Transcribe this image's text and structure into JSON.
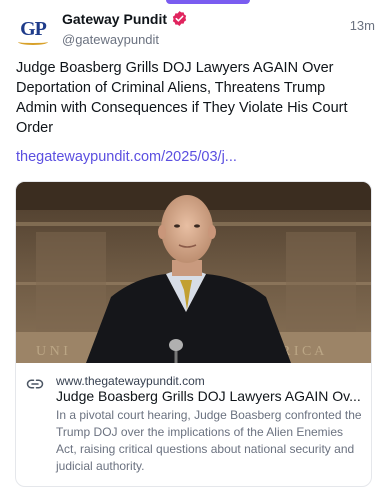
{
  "post": {
    "author": {
      "display_name": "Gateway Pundit",
      "handle": "@gatewaypundit",
      "avatar_initials": "GP",
      "verified_icon": "verified-badge-icon"
    },
    "timestamp": "13m",
    "text": "Judge Boasberg Grills DOJ Lawyers AGAIN Over Deportation of Criminal Aliens, Threatens Trump Admin with Consequences if They Violate His Court Order",
    "link_text": "thegatewaypundit.com/2025/03/j..."
  },
  "card": {
    "domain": "www.thegatewaypundit.com",
    "title": "Judge Boasberg Grills DOJ Lawyers AGAIN Ov...",
    "description": "In a pivotal court hearing, Judge Boasberg confronted the Trump DOJ over the implications of the Alien Enemies Act, raising critical questions about national security and judicial authority.",
    "link_icon": "link-icon"
  },
  "colors": {
    "accent": "#5b4fe0",
    "verified": "#e0245e",
    "brand_blue": "#1e3b8a",
    "brand_gold": "#d8a12a"
  }
}
